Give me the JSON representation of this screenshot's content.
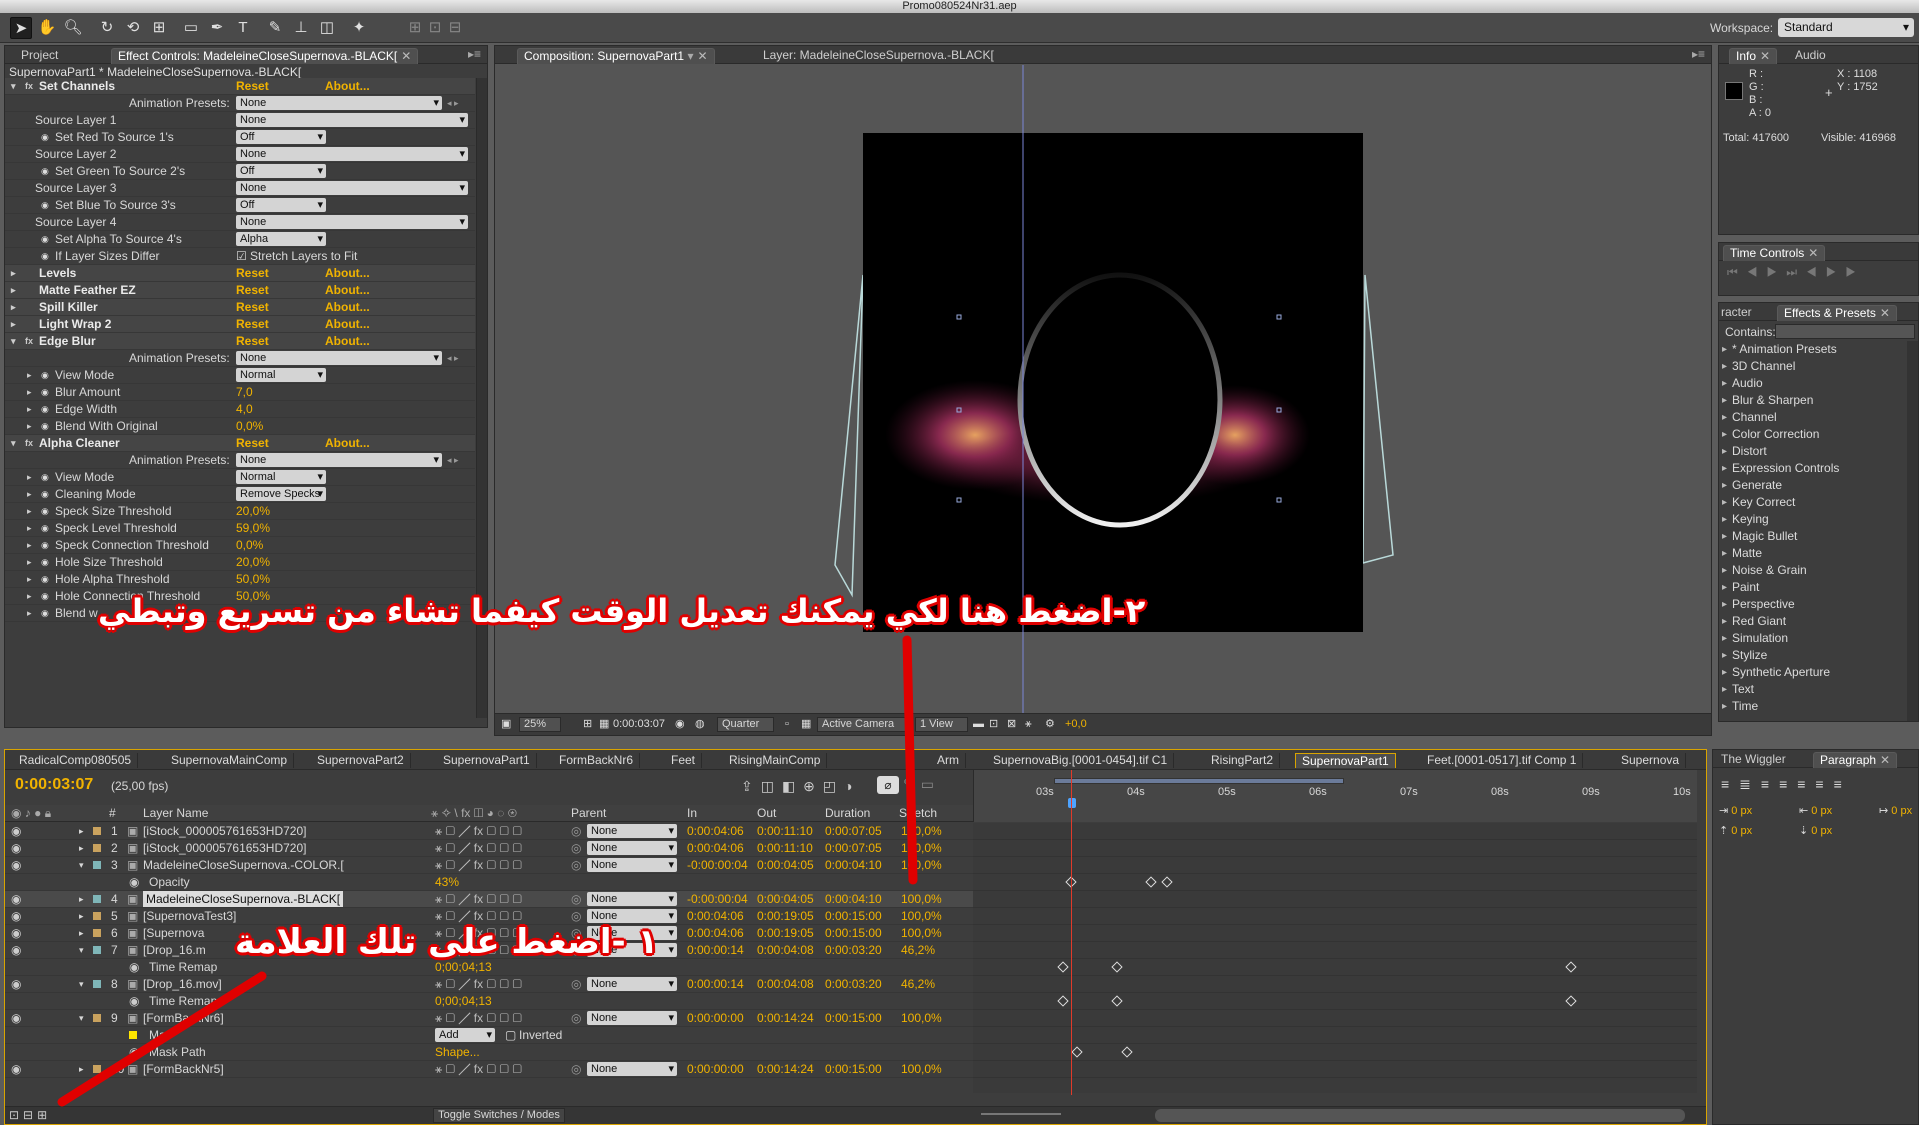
{
  "window_title": "Promo080524Nr31.aep",
  "toolbar": {
    "workspace_label": "Workspace:",
    "workspace_value": "Standard",
    "tools": [
      "selection-tool",
      "hand-tool",
      "zoom-tool",
      "rotation-tool",
      "orbit-camera-tool",
      "pan-behind-tool",
      "rectangle-mask-tool",
      "pen-tool",
      "type-tool",
      "brush-tool",
      "clone-stamp-tool",
      "eraser-tool",
      "puppet-pin-tool"
    ]
  },
  "left_panel": {
    "tab_project": "Project",
    "tab_effect_controls": "Effect Controls: MadeleineCloseSupernova.-BLACK[",
    "subtitle": "SupernovaPart1 * MadeleineCloseSupernova.-BLACK[",
    "reset": "Reset",
    "about": "About...",
    "rows": [
      {
        "kind": "effect",
        "name": "Set Channels",
        "open": true
      },
      {
        "kind": "preset",
        "name": "Animation Presets:",
        "value": "None"
      },
      {
        "kind": "dd",
        "name": "Source Layer 1",
        "value": "None",
        "wide": true
      },
      {
        "kind": "dd",
        "name": "Set Red To Source 1's",
        "value": "Off",
        "sw": true
      },
      {
        "kind": "dd",
        "name": "Source Layer 2",
        "value": "None",
        "wide": true
      },
      {
        "kind": "dd",
        "name": "Set Green To Source 2's",
        "value": "Off",
        "sw": true
      },
      {
        "kind": "dd",
        "name": "Source Layer 3",
        "value": "None",
        "wide": true
      },
      {
        "kind": "dd",
        "name": "Set Blue To Source 3's",
        "value": "Off",
        "sw": true
      },
      {
        "kind": "dd",
        "name": "Source Layer 4",
        "value": "None",
        "wide": true
      },
      {
        "kind": "dd",
        "name": "Set Alpha To Source 4's",
        "value": "Alpha",
        "sw": true
      },
      {
        "kind": "check",
        "name": "If Layer Sizes Differ",
        "value": "Stretch Layers to Fit",
        "sw": true
      },
      {
        "kind": "effect",
        "name": "Levels",
        "open": false
      },
      {
        "kind": "effect",
        "name": "Matte Feather EZ",
        "open": false
      },
      {
        "kind": "effect",
        "name": "Spill Killer",
        "open": false
      },
      {
        "kind": "effect",
        "name": "Light Wrap 2",
        "open": false
      },
      {
        "kind": "effect",
        "name": "Edge Blur",
        "open": true
      },
      {
        "kind": "preset",
        "name": "Animation Presets:",
        "value": "None"
      },
      {
        "kind": "dd",
        "name": "View Mode",
        "value": "Normal",
        "sw": true,
        "tri": true
      },
      {
        "kind": "val",
        "name": "Blur Amount",
        "value": "7,0",
        "sw": true,
        "tri": true
      },
      {
        "kind": "val",
        "name": "Edge Width",
        "value": "4,0",
        "sw": true,
        "tri": true
      },
      {
        "kind": "val",
        "name": "Blend With Original",
        "value": "0,0%",
        "sw": true,
        "tri": true
      },
      {
        "kind": "effect",
        "name": "Alpha Cleaner",
        "open": true
      },
      {
        "kind": "preset",
        "name": "Animation Presets:",
        "value": "None"
      },
      {
        "kind": "dd",
        "name": "View Mode",
        "value": "Normal",
        "sw": true,
        "tri": true
      },
      {
        "kind": "dd",
        "name": "Cleaning Mode",
        "value": "Remove Specks",
        "sw": true,
        "tri": true
      },
      {
        "kind": "val",
        "name": "Speck Size Threshold",
        "value": "20,0%",
        "sw": true,
        "tri": true
      },
      {
        "kind": "val",
        "name": "Speck Level Threshold",
        "value": "59,0%",
        "sw": true,
        "tri": true
      },
      {
        "kind": "val",
        "name": "Speck Connection Threshold",
        "value": "0,0%",
        "sw": true,
        "tri": true
      },
      {
        "kind": "val",
        "name": "Hole Size Threshold",
        "value": "20,0%",
        "sw": true,
        "tri": true
      },
      {
        "kind": "val",
        "name": "Hole Alpha Threshold",
        "value": "50,0%",
        "sw": true,
        "tri": true
      },
      {
        "kind": "val",
        "name": "Hole Connection Threshold",
        "value": "50,0%",
        "sw": true,
        "tri": true
      },
      {
        "kind": "val",
        "name": "Blend w",
        "value": "",
        "sw": true,
        "tri": true
      }
    ]
  },
  "composition": {
    "tab_comp": "Composition: SupernovaPart1",
    "tab_layer": "Layer: MadeleineCloseSupernova.-BLACK[",
    "zoom": "25%",
    "timecode": "0:00:03:07",
    "resolution": "Quarter",
    "camera": "Active Camera",
    "views": "1 View",
    "exposure": "+0,0"
  },
  "info": {
    "tab_info": "Info",
    "tab_audio": "Audio",
    "r": "R :",
    "g": "G :",
    "b": "B :",
    "a": "A : 0",
    "x": "X : 1108",
    "y": "Y : 1752",
    "total": "Total: 417600",
    "visible": "Visible: 416968"
  },
  "time_controls": {
    "tab": "Time Controls"
  },
  "effects_presets": {
    "tab_character": "racter",
    "tab": "Effects & Presets",
    "contains_label": "Contains:",
    "items": [
      "* Animation Presets",
      "3D Channel",
      "Audio",
      "Blur & Sharpen",
      "Channel",
      "Color Correction",
      "Distort",
      "Expression Controls",
      "Generate",
      "Key Correct",
      "Keying",
      "Magic Bullet",
      "Matte",
      "Noise & Grain",
      "Paint",
      "Perspective",
      "Red Giant",
      "Simulation",
      "Stylize",
      "Synthetic Aperture",
      "Text",
      "Time"
    ]
  },
  "wiggler": {
    "tab_wiggler": "The Wiggler",
    "tab_paragraph": "Paragraph",
    "px_values": [
      "0 px",
      "0 px",
      "0 px",
      "0 px",
      "0 px"
    ]
  },
  "timeline": {
    "tabs": [
      "RadicalComp080505",
      "SupernovaMainComp",
      "SupernovaPart2",
      "SupernovaPart1",
      "FormBackNr6",
      "Feet",
      "RisingMainComp",
      "Arm",
      "SupernovaBig.[0001-0454].tif C1",
      "RisingPart2",
      "SupernovaPart1",
      "Feet.[0001-0517].tif Comp 1",
      "Supernova"
    ],
    "active_tab": 10,
    "current_time": "0:00:03:07",
    "fps": "(25,00 fps)",
    "columns": {
      "num": "#",
      "layer_name": "Layer Name",
      "parent": "Parent",
      "in": "In",
      "out": "Out",
      "duration": "Duration",
      "stretch": "Stretch"
    },
    "ruler": [
      "03s",
      "04s",
      "05s",
      "06s",
      "07s",
      "08s",
      "09s",
      "10s"
    ],
    "toggle_label": "Toggle Switches / Modes",
    "rows": [
      {
        "num": "1",
        "name": "[iStock_000005761653HD720]",
        "parent": "None",
        "in": "0:00:04:06",
        "out": "0:00:11:10",
        "dur": "0:00:07:05",
        "str": "100,0%",
        "color": "#c9a25e"
      },
      {
        "num": "2",
        "name": "[iStock_000005761653HD720]",
        "parent": "None",
        "in": "0:00:04:06",
        "out": "0:00:11:10",
        "dur": "0:00:07:05",
        "str": "100,0%",
        "color": "#c9a25e"
      },
      {
        "num": "3",
        "name": "MadeleineCloseSupernova.-COLOR.[",
        "parent": "None",
        "in": "-0:00:00:04",
        "out": "0:00:04:05",
        "dur": "0:00:04:10",
        "str": "100,0%",
        "color": "#7fb6b8",
        "open": true
      },
      {
        "sub": true,
        "name": "Opacity",
        "value": "43%"
      },
      {
        "num": "4",
        "name": "MadeleineCloseSupernova.-BLACK[",
        "parent": "None",
        "in": "-0:00:00:04",
        "out": "0:00:04:05",
        "dur": "0:00:04:10",
        "str": "100,0%",
        "color": "#7fb6b8",
        "sel": true
      },
      {
        "num": "5",
        "name": "[SupernovaTest3]",
        "parent": "None",
        "in": "0:00:04:06",
        "out": "0:00:19:05",
        "dur": "0:00:15:00",
        "str": "100,0%",
        "color": "#c9a25e"
      },
      {
        "num": "6",
        "name": "[Supernova",
        "parent": "None",
        "in": "0:00:04:06",
        "out": "0:00:19:05",
        "dur": "0:00:15:00",
        "str": "100,0%",
        "color": "#c9a25e"
      },
      {
        "num": "7",
        "name": "[Drop_16.m",
        "parent": "None",
        "in": "0:00:00:14",
        "out": "0:00:04:08",
        "dur": "0:00:03:20",
        "str": "46,2%",
        "color": "#7fb6b8",
        "open": true
      },
      {
        "sub": true,
        "name": "Time Remap",
        "value": "0;00;04;13"
      },
      {
        "num": "8",
        "name": "[Drop_16.mov]",
        "parent": "None",
        "in": "0:00:00:14",
        "out": "0:00:04:08",
        "dur": "0:00:03:20",
        "str": "46,2%",
        "color": "#7fb6b8",
        "open": true
      },
      {
        "sub": true,
        "name": "Time Remap",
        "value": "0;00;04;13"
      },
      {
        "num": "9",
        "name": "[FormBackNr6]",
        "parent": "None",
        "in": "0:00:00:00",
        "out": "0:00:14:24",
        "dur": "0:00:15:00",
        "str": "100,0%",
        "color": "#c9a25e",
        "open": true
      },
      {
        "mask": true,
        "name": "Ma",
        "mode": "Add",
        "inverted": "Inverted"
      },
      {
        "sub": true,
        "name": "Mask Path",
        "value": "Shape..."
      },
      {
        "num": "10",
        "name": "[FormBackNr5]",
        "parent": "None",
        "in": "0:00:00:00",
        "out": "0:00:14:24",
        "dur": "0:00:15:00",
        "str": "100,0%",
        "color": "#c9a25e"
      }
    ]
  },
  "annotations": {
    "step2": "٢-اضغط هنا لكي يمكنك تعديل الوقت كيفما تشاء من تسريع وتبطي",
    "step1": "١ -اضغط على تلك العلامة",
    "color": "#e00000"
  }
}
